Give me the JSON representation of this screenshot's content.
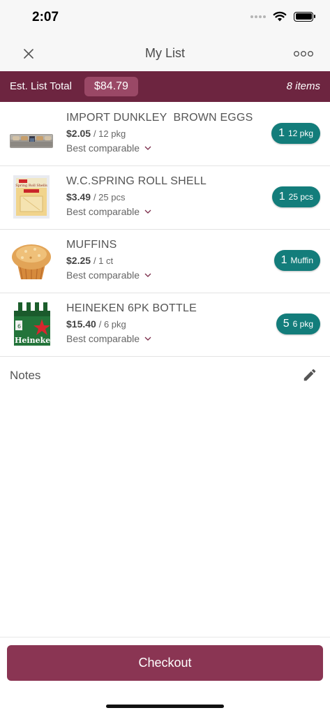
{
  "status_bar": {
    "time": "2:07"
  },
  "nav": {
    "title": "My List",
    "close_icon": "close-icon",
    "more_icon": "more-options-icon"
  },
  "summary": {
    "label": "Est. List Total",
    "total": "$84.79",
    "count": "8 items"
  },
  "items": [
    {
      "name": "IMPORT DUNKLEY  BROWN EGGS",
      "price": "$2.05",
      "unit": "/ 12 pkg",
      "comparable": "Best comparable",
      "qty": "1",
      "qty_unit": "12 pkg",
      "image": "brown-eggs-carton"
    },
    {
      "name": "W.C.SPRING ROLL SHELL",
      "price": "$3.49",
      "unit": "/ 25 pcs",
      "comparable": "Best comparable",
      "qty": "1",
      "qty_unit": "25 pcs",
      "image": "spring-roll-package"
    },
    {
      "name": "MUFFINS",
      "price": "$2.25",
      "unit": "/ 1 ct",
      "comparable": "Best comparable",
      "qty": "1",
      "qty_unit": "Muffin",
      "image": "muffin"
    },
    {
      "name": "HEINEKEN 6PK BOTTLE",
      "price": "$15.40",
      "unit": "/ 6 pkg",
      "comparable": "Best comparable",
      "qty": "5",
      "qty_unit": "6 pkg",
      "image": "beer-six-pack"
    }
  ],
  "notes": {
    "label": "Notes",
    "edit_icon": "pencil-icon"
  },
  "checkout": {
    "label": "Checkout"
  },
  "colors": {
    "brand_dark": "#6d2540",
    "brand": "#8a3553",
    "accent_teal": "#137d7b"
  },
  "image_text": {
    "spring_roll_pack": "Spring Roll Shells",
    "heineken_label": "Heineken"
  }
}
